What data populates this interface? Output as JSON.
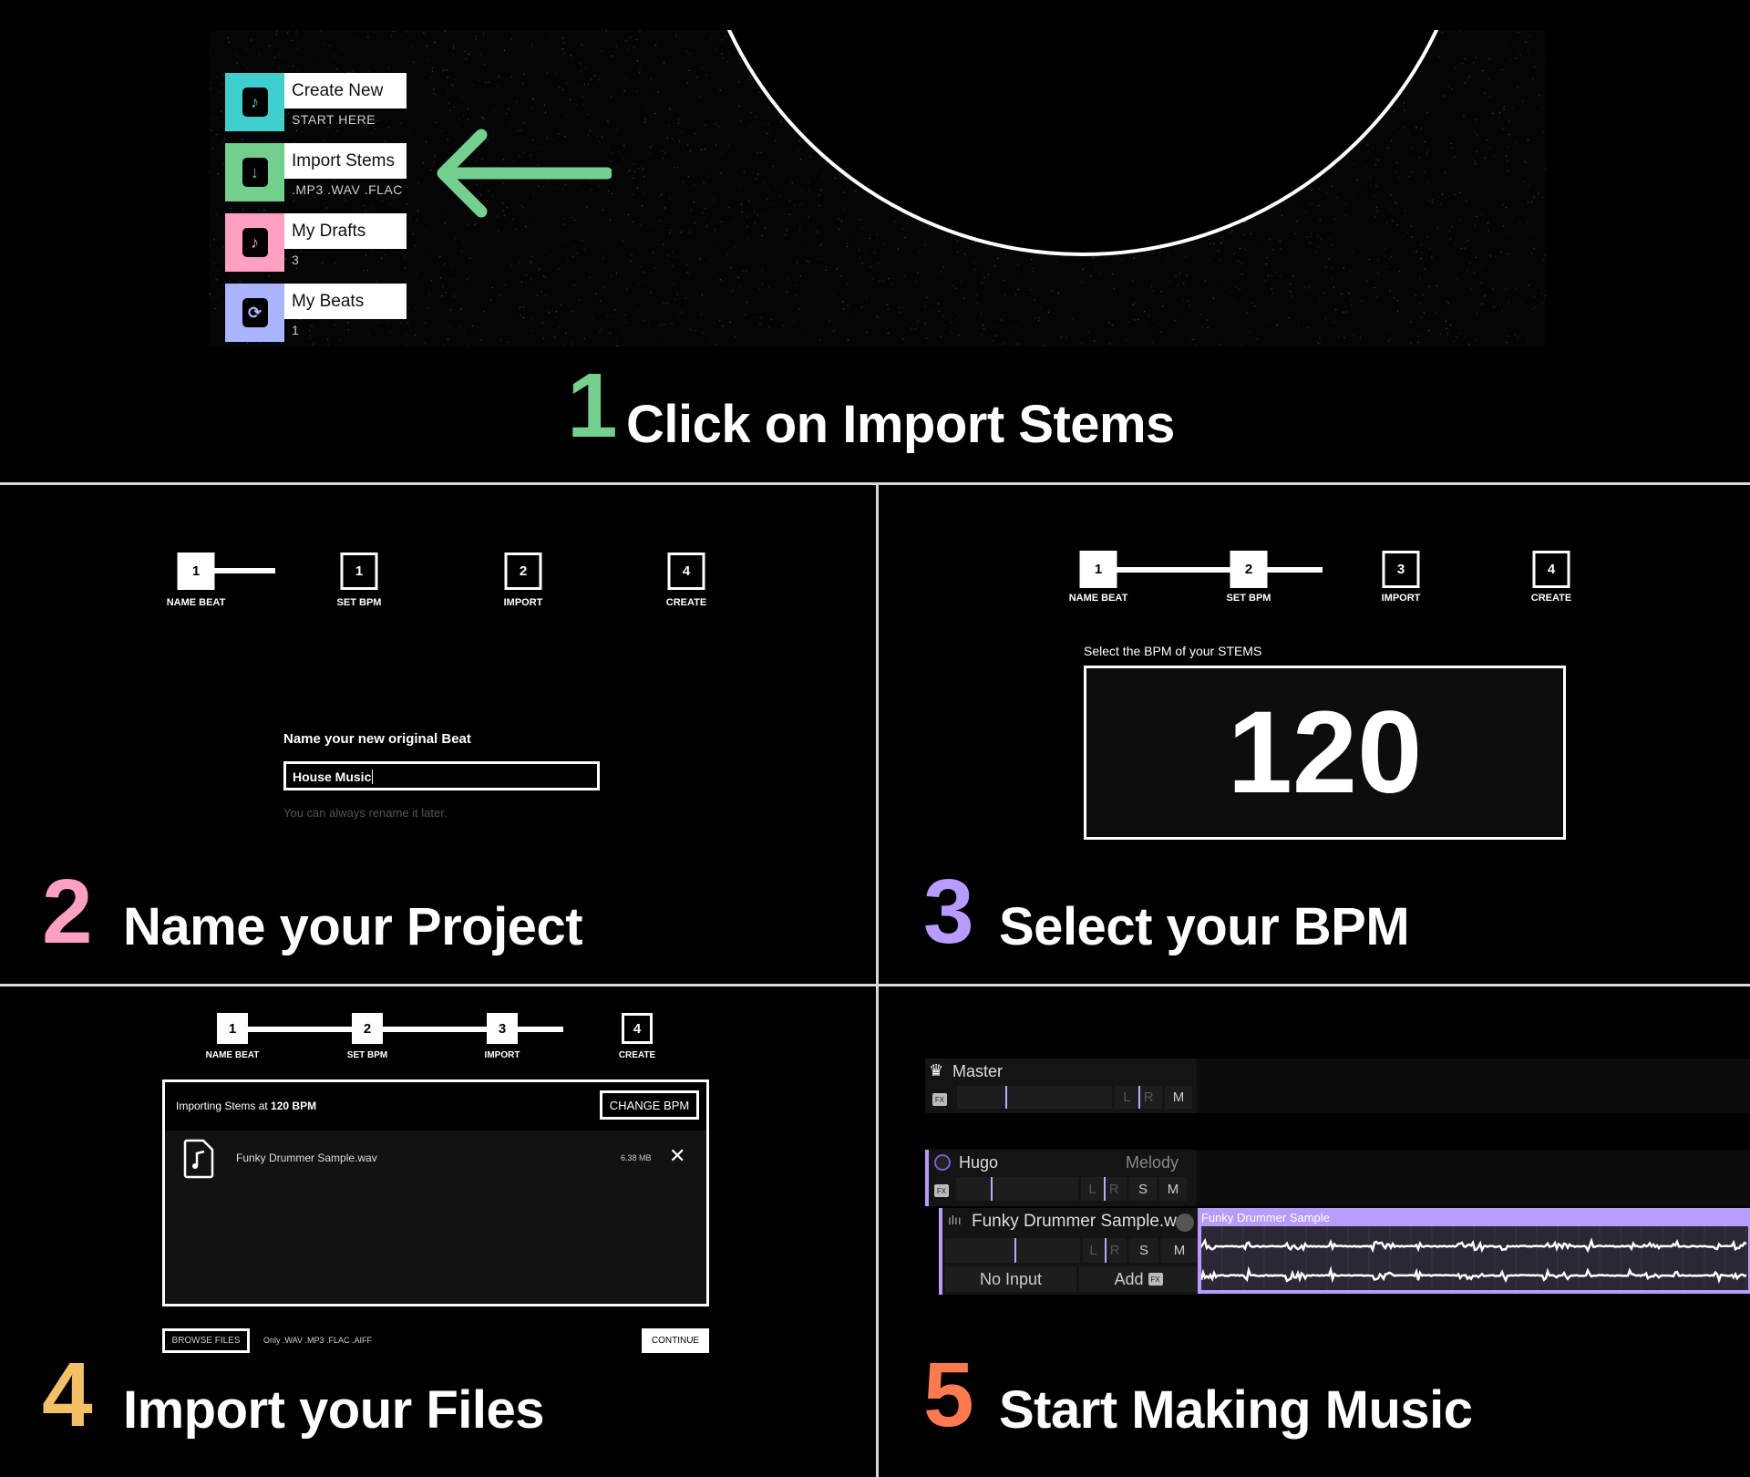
{
  "colors": {
    "step1": "#74d08f",
    "step2": "#ff9fc4",
    "step3": "#b79bff",
    "step4": "#f4c064",
    "step5": "#ff7a4f",
    "clip": "#b79bff"
  },
  "panel1": {
    "menu": [
      {
        "label": "Create New",
        "sub": "START HERE",
        "color": "#3fcfcf",
        "icon": "music-plus-icon"
      },
      {
        "label": "Import Stems",
        "sub": ".MP3 .WAV .FLAC",
        "color": "#72cf8c",
        "icon": "file-download-icon"
      },
      {
        "label": "My Drafts",
        "sub": "3",
        "color": "#ff9fc4",
        "icon": "music-file-icon"
      },
      {
        "label": "My Beats",
        "sub": "1",
        "color": "#aab4ff",
        "icon": "beats-stack-icon"
      }
    ],
    "number": "1",
    "title": "Click on Import Stems"
  },
  "stepper": {
    "labels": [
      "NAME BEAT",
      "SET BPM",
      "IMPORT",
      "CREATE"
    ]
  },
  "panel2": {
    "boxes": [
      "1",
      "1",
      "2",
      "4"
    ],
    "field_label": "Name your new original Beat",
    "field_value": "House Music",
    "hint": "You can always rename it later.",
    "number": "2",
    "title": "Name your Project"
  },
  "panel3": {
    "boxes": [
      "1",
      "2",
      "3",
      "4"
    ],
    "prompt": "Select the BPM of your STEMS",
    "bpm": "120",
    "number": "3",
    "title": "Select your BPM"
  },
  "panel4": {
    "boxes": [
      "1",
      "2",
      "3",
      "4"
    ],
    "importing_prefix": "Importing Stems at ",
    "importing_bpm": "120 BPM",
    "change_bpm": "CHANGE BPM",
    "file_name": "Funky Drummer Sample.wav",
    "file_size": "6.38 MB",
    "browse": "BROWSE FILES",
    "formats": "Only .WAV .MP3 .FLAC .AIFF",
    "continue": "CONTINUE",
    "number": "4",
    "title": "Import your Files"
  },
  "panel5": {
    "master": "Master",
    "fx": "FX",
    "l": "L",
    "r": "R",
    "s": "S",
    "m": "M",
    "track": "Hugo",
    "track_type": "Melody",
    "stem": "Funky Drummer Sample.w",
    "input": "No Input",
    "add": "Add",
    "clip": "Funky Drummer Sample",
    "number": "5",
    "title": "Start Making Music"
  }
}
